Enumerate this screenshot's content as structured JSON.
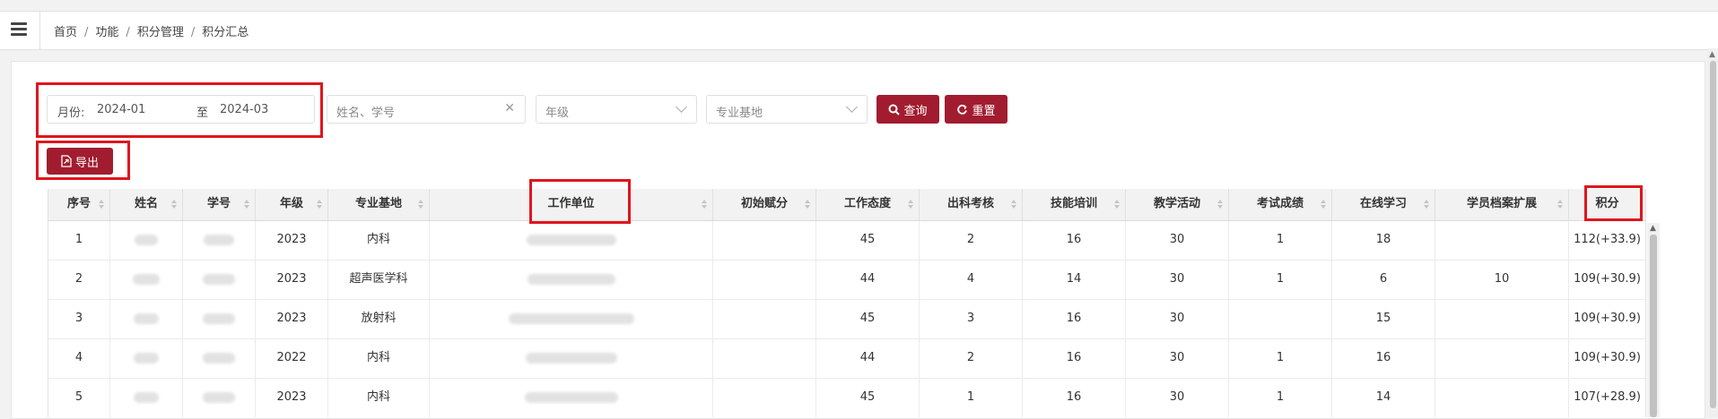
{
  "breadcrumb": {
    "items": [
      "首页",
      "功能",
      "积分管理",
      "积分汇总"
    ],
    "separator": "/"
  },
  "filters": {
    "month_label": "月份:",
    "start_month": "2024-01",
    "range_to": "至",
    "end_month": "2024-03",
    "name_placeholder": "姓名、学号",
    "grade_placeholder": "年级",
    "base_placeholder": "专业基地",
    "query_label": "查询",
    "reset_label": "重置",
    "export_label": "导出"
  },
  "table": {
    "columns": [
      "序号",
      "姓名",
      "学号",
      "年级",
      "专业基地",
      "工作单位",
      "初始赋分",
      "工作态度",
      "出科考核",
      "技能培训",
      "教学活动",
      "考试成绩",
      "在线学习",
      "学员档案扩展",
      "积分"
    ],
    "rows": [
      {
        "no": "1",
        "grade": "2023",
        "base": "内科",
        "initial": "",
        "attitude": "45",
        "rotation": "2",
        "skill": "16",
        "teaching": "30",
        "exam": "1",
        "online": "18",
        "archive": "",
        "points": "112(+33.9)"
      },
      {
        "no": "2",
        "grade": "2023",
        "base": "超声医学科",
        "initial": "",
        "attitude": "44",
        "rotation": "4",
        "skill": "14",
        "teaching": "30",
        "exam": "1",
        "online": "6",
        "archive": "10",
        "points": "109(+30.9)"
      },
      {
        "no": "3",
        "grade": "2023",
        "base": "放射科",
        "initial": "",
        "attitude": "45",
        "rotation": "3",
        "skill": "16",
        "teaching": "30",
        "exam": "",
        "online": "15",
        "archive": "",
        "points": "109(+30.9)"
      },
      {
        "no": "4",
        "grade": "2022",
        "base": "内科",
        "initial": "",
        "attitude": "44",
        "rotation": "2",
        "skill": "16",
        "teaching": "30",
        "exam": "1",
        "online": "16",
        "archive": "",
        "points": "109(+30.9)"
      },
      {
        "no": "5",
        "grade": "2023",
        "base": "内科",
        "initial": "",
        "attitude": "45",
        "rotation": "1",
        "skill": "16",
        "teaching": "30",
        "exam": "1",
        "online": "14",
        "archive": "",
        "points": "107(+28.9)"
      }
    ]
  },
  "colors": {
    "accent": "#a21c2f",
    "highlight": "#e0151c",
    "header_bg": "#f2f2f2"
  },
  "icons": {
    "menu": "hamburger-icon",
    "query": "search-icon",
    "reset": "refresh-icon",
    "export": "export-file-icon",
    "clear": "clear-icon",
    "select": "chevron-down-icon",
    "sort": "sort-icon"
  }
}
